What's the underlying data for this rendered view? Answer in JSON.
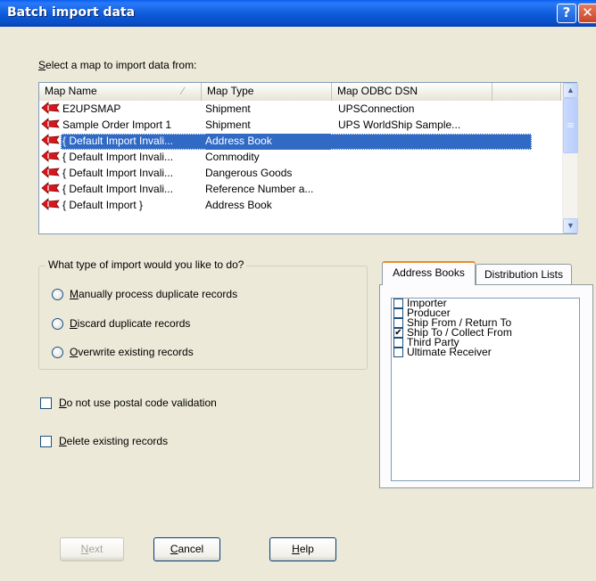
{
  "window": {
    "title": "Batch import data",
    "help_glyph": "?",
    "close_glyph": "✕"
  },
  "map_section": {
    "prompt_pre": "",
    "prompt_mnemonic": "S",
    "prompt_rest": "elect a map to import data from:",
    "columns": [
      "Map Name",
      "Map Type",
      "Map ODBC DSN"
    ],
    "sort_indicator": "∕",
    "rows": [
      {
        "name": "E2UPSMAP",
        "type": "Shipment",
        "dsn": "UPSConnection",
        "icon": "red-flag-icon"
      },
      {
        "name": "Sample Order Import 1",
        "type": "Shipment",
        "dsn": "UPS WorldShip Sample...",
        "icon": "red-flag-icon"
      },
      {
        "name": "{ Default Import Invali...",
        "type": "Address Book",
        "dsn": "",
        "icon": "red-flag-icon",
        "selected": true
      },
      {
        "name": "{ Default Import Invali...",
        "type": "Commodity",
        "dsn": "",
        "icon": "red-flag-icon"
      },
      {
        "name": "{ Default Import Invali...",
        "type": "Dangerous Goods",
        "dsn": "",
        "icon": "red-flag-icon"
      },
      {
        "name": "{ Default Import Invali...",
        "type": "Reference Number a...",
        "dsn": "",
        "icon": "red-flag-icon"
      },
      {
        "name": "{ Default Import }",
        "type": "Address Book",
        "dsn": "",
        "icon": "red-flag-icon"
      }
    ]
  },
  "import_type": {
    "title": "What type of import would you like to do?",
    "options": [
      {
        "mnemonic": "M",
        "rest": "anually process duplicate records",
        "selected": false
      },
      {
        "mnemonic": "D",
        "rest": "iscard duplicate records",
        "selected": false
      },
      {
        "mnemonic": "O",
        "rest": "verwrite existing records",
        "selected": false
      }
    ]
  },
  "checkboxes": [
    {
      "mnemonic": "D",
      "rest": "o not use postal code validation",
      "checked": false
    },
    {
      "mnemonic": "D",
      "rest": "elete existing records",
      "checked": false
    }
  ],
  "tabs": {
    "items": [
      "Address Books",
      "Distribution Lists"
    ],
    "active_index": 0,
    "address_books": [
      {
        "label": "Importer",
        "checked": false
      },
      {
        "label": "Producer",
        "checked": false
      },
      {
        "label": "Ship From / Return To",
        "checked": false
      },
      {
        "label": "Ship To / Collect From",
        "checked": true
      },
      {
        "label": "Third Party",
        "checked": false
      },
      {
        "label": "Ultimate Receiver",
        "checked": false
      }
    ]
  },
  "buttons": {
    "next": {
      "mnemonic": "N",
      "rest": "ext",
      "enabled": false
    },
    "cancel": {
      "mnemonic": "C",
      "rest": "ancel",
      "enabled": true
    },
    "help": {
      "mnemonic": "H",
      "rest": "elp",
      "enabled": true
    }
  },
  "colors": {
    "title_bar": "#0a5ad8",
    "selection": "#316ac5",
    "dialog_bg": "#ece9d8",
    "flag_red": "#d8161b"
  },
  "check_glyph": "✔",
  "scroll_up_glyph": "▲",
  "scroll_down_glyph": "▼"
}
